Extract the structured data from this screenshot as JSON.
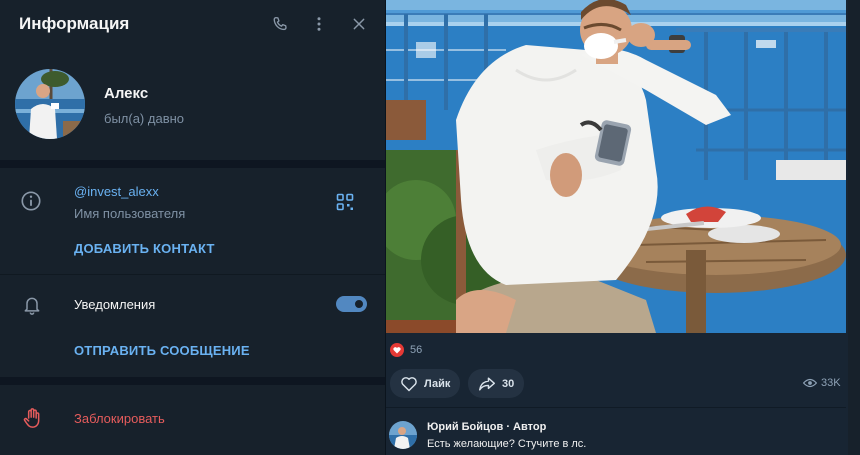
{
  "header": {
    "title": "Информация"
  },
  "profile": {
    "name": "Алекс",
    "status": "был(а) давно"
  },
  "info": {
    "username": "@invest_alexx",
    "username_caption": "Имя пользователя",
    "add_contact_label": "ДОБАВИТЬ КОНТАКТ"
  },
  "notifications": {
    "label": "Уведомления",
    "enabled": true,
    "send_message_label": "ОТПРАВИТЬ СООБЩЕНИЕ"
  },
  "block": {
    "label": "Заблокировать"
  },
  "post": {
    "reaction_count": "56",
    "like_label": "Лайк",
    "share_count": "30",
    "views": "33K"
  },
  "comment": {
    "author": "Юрий Бойцов · Автор",
    "text": "Есть желающие? Стучите в лс."
  },
  "colors": {
    "accent": "#6ab2f2",
    "danger": "#e65c5c",
    "toggle_on": "#5288c1"
  }
}
